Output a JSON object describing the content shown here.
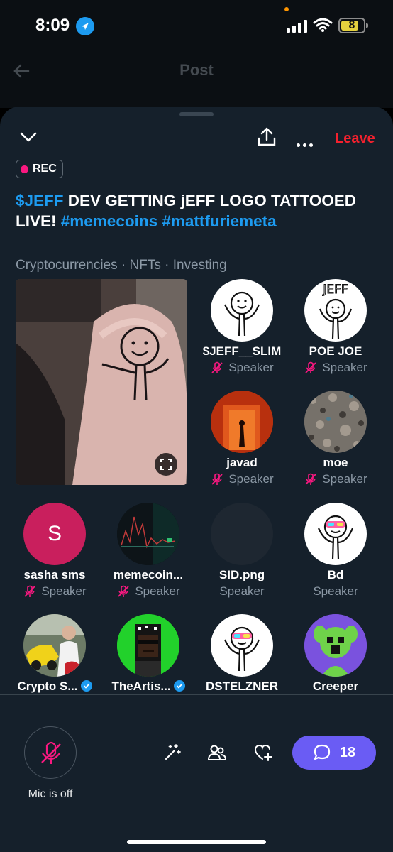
{
  "status_bar": {
    "time": "8:09",
    "battery": "8"
  },
  "header": {
    "title": "Post"
  },
  "sheet": {
    "leave_label": "Leave",
    "rec_label": "REC"
  },
  "space": {
    "title_parts": [
      "$JEFF",
      " DEV GETTING jEFF LOGO TATTOOED LIVE! ",
      "#memecoins",
      " ",
      "#mattfuriemeta"
    ],
    "topics": "Cryptocurrencies · NFTs · Investing"
  },
  "participants": [
    {
      "name": "$JEFF__SLIM",
      "role": "Speaker"
    },
    {
      "name": "POE JOE",
      "role": "Speaker"
    },
    {
      "name": "javad",
      "role": "Speaker"
    },
    {
      "name": "moe",
      "role": "Speaker"
    },
    {
      "name": "sasha sms",
      "role": "Speaker",
      "initial": "S"
    },
    {
      "name": "memecoin...",
      "role": "Speaker"
    },
    {
      "name": "SID.png",
      "role": "Speaker"
    },
    {
      "name": "Bd",
      "role": "Speaker"
    },
    {
      "name": "Crypto S...",
      "role": ""
    },
    {
      "name": "TheArtis...",
      "role": ""
    },
    {
      "name": "DSTELZNER",
      "role": ""
    },
    {
      "name": "Creeper",
      "role": ""
    }
  ],
  "bottom": {
    "mic_label": "Mic is off",
    "chat_count": "18"
  },
  "colors": {
    "accent": "#1d9bf0",
    "leave": "#f4212e",
    "rec": "#f91880",
    "chat": "#6a5cf4",
    "muted": "#f91880"
  }
}
